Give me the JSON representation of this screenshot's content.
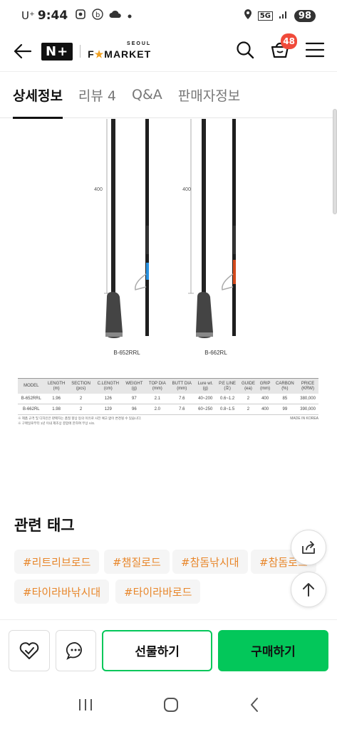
{
  "status_bar": {
    "carrier": "U⁺",
    "time": "9:44",
    "network": "5G",
    "battery": "98"
  },
  "header": {
    "logo_nplus": "N+",
    "logo_seoul": "SEOUL",
    "logo_fmarket_f": "F",
    "logo_fmarket_star": "★",
    "logo_fmarket_rest": "MARKET",
    "cart_count": "48",
    "icons": [
      "back-arrow-icon",
      "search-icon",
      "cart-icon",
      "menu-icon"
    ]
  },
  "tabs": [
    {
      "label": "상세정보",
      "active": true
    },
    {
      "label": "리뷰 4",
      "active": false
    },
    {
      "label": "Q&A",
      "active": false
    },
    {
      "label": "판매자정보",
      "active": false
    }
  ],
  "product_image": {
    "dimension_label_left": "400",
    "dimension_label_right": "400",
    "model_left": "B-652RRL",
    "model_right": "B-662RL",
    "accent_left": "#2a9df4",
    "accent_right": "#e8501e"
  },
  "spec_table": {
    "headers": [
      {
        "name": "MODEL",
        "unit": ""
      },
      {
        "name": "LENGTH",
        "unit": "(m)"
      },
      {
        "name": "SECTION",
        "unit": "(pcs)"
      },
      {
        "name": "C.LENGTH",
        "unit": "(cm)"
      },
      {
        "name": "WEIGHT",
        "unit": "(g)"
      },
      {
        "name": "TOP DIA",
        "unit": "(mm)"
      },
      {
        "name": "BUTT DIA",
        "unit": "(mm)"
      },
      {
        "name": "Lure wt.",
        "unit": "(g)"
      },
      {
        "name": "P.E LINE",
        "unit": "(호)"
      },
      {
        "name": "GUIDE",
        "unit": "(ea)"
      },
      {
        "name": "GRIP",
        "unit": "(mm)"
      },
      {
        "name": "CARBON",
        "unit": "(%)"
      },
      {
        "name": "PRICE",
        "unit": "(KRW)"
      }
    ],
    "rows": [
      [
        "B-652RRL",
        "1.96",
        "2",
        "126",
        "97",
        "2.1",
        "7.6",
        "40~200",
        "0.6~1.2",
        "2",
        "400",
        "85",
        "380,000"
      ],
      [
        "B-662RL",
        "1.98",
        "2",
        "129",
        "96",
        "2.0",
        "7.6",
        "60~250",
        "0.8~1.5",
        "2",
        "400",
        "99",
        "390,000"
      ]
    ],
    "note_1": "※ 제품 규격 및 디자인은 판매자는 품질 향상 등의 이유로 사전 예고 없이 변경될 수 있습니다.",
    "note_2": "※ 구매일로부터 1년 이내 제조상 결함에 한하여 무상 A/S.",
    "made_in": "MADE IN KOREA"
  },
  "tags": {
    "title": "관련 태그",
    "items": [
      "#리트리브로드",
      "#챔질로드",
      "#참돔낚시대",
      "#참돔로드",
      "#타이라바낚시대",
      "#타이라바로드"
    ]
  },
  "bottom_bar": {
    "gift_label": "선물하기",
    "buy_label": "구매하기",
    "accent": "#03c75a"
  }
}
